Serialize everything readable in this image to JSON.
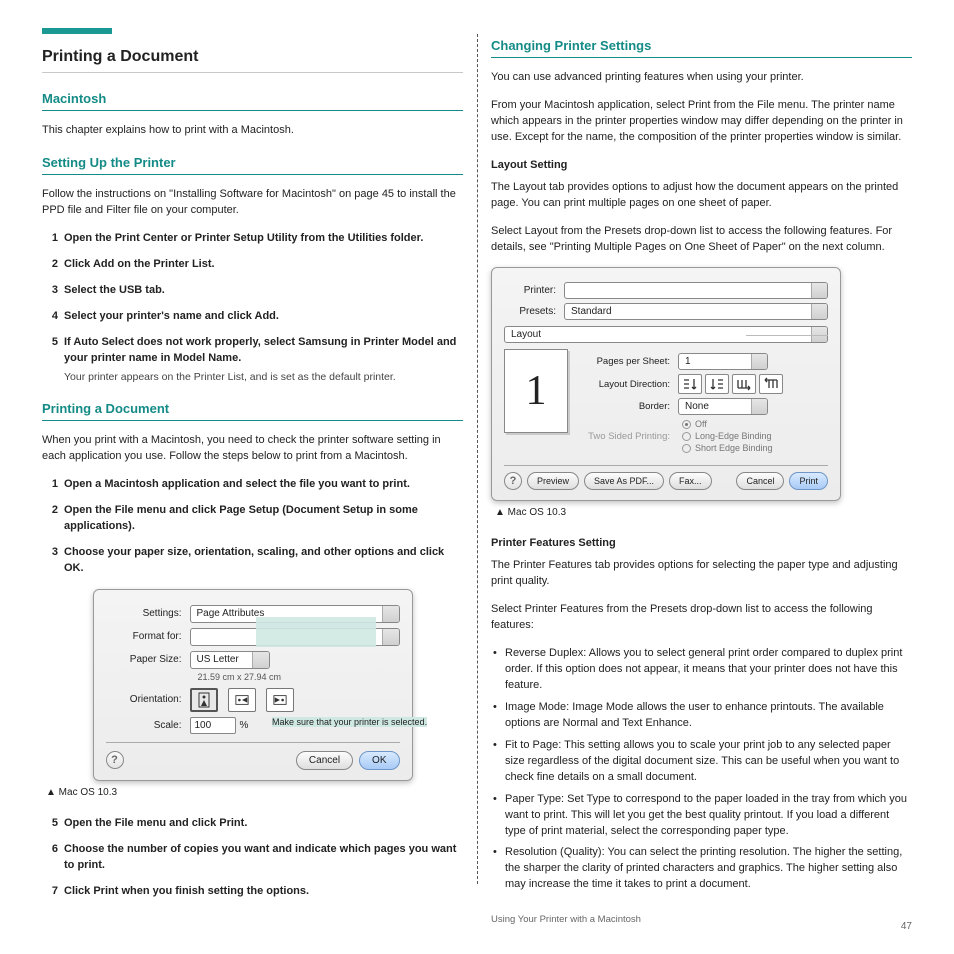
{
  "page_number": "47",
  "left": {
    "section_title": "Printing a Document",
    "sub1": "Macintosh",
    "intro": "This chapter explains how to print with a Macintosh.",
    "sub2": "Setting Up the Printer",
    "setup_text": "Follow the instructions on \"Installing Software for Macintosh\" on page 45 to install the PPD file and Filter file on your computer.",
    "steps": [
      {
        "head": "Open the Print Center or Printer Setup Utility from the Utilities folder."
      },
      {
        "head": "Click Add on the Printer List."
      },
      {
        "head": "Select the USB tab."
      },
      {
        "head": "Select your printer's name and click Add."
      },
      {
        "head": "If Auto Select does not work properly, select Samsung in Printer Model and your printer name in Model Name.",
        "sub": "Your printer appears on the Printer List, and is set as the default printer."
      }
    ],
    "sub3": "Printing a Document",
    "doc_text": "When you print with a Macintosh, you need to check the printer software setting in each application you use. Follow the steps below to print from a Macintosh.",
    "doc_steps": [
      {
        "head": "Open a Macintosh application and select the file you want to print."
      },
      {
        "head": "Open the File menu and click Page Setup (Document Setup in some applications)."
      },
      {
        "head": "Choose your paper size, orientation, scaling, and other options and click OK."
      }
    ],
    "callout_text": "Make sure that your printer is selected.",
    "caption1": "▲  Mac OS 10.3",
    "followup_steps": [
      {
        "num": "5",
        "head": "Open the File menu and click Print."
      },
      {
        "num": "6",
        "head": "Choose the number of copies you want and indicate which pages you want to print."
      },
      {
        "num": "7",
        "head": "Click Print when you finish setting the options."
      }
    ],
    "page_setup": {
      "settings_label": "Settings:",
      "settings_val": "Page Attributes",
      "format_label": "Format for:",
      "format_val": "",
      "paper_label": "Paper Size:",
      "paper_val": "US Letter",
      "paper_dim": "21.59 cm x 27.94 cm",
      "orient_label": "Orientation:",
      "scale_label": "Scale:",
      "scale_val": "100",
      "scale_suffix": "%",
      "cancel": "Cancel",
      "ok": "OK"
    }
  },
  "right": {
    "sub1": "Changing Printer Settings",
    "intro": "You can use advanced printing features when using your printer.",
    "text1": "From your Macintosh application, select Print from the File menu. The printer name which appears in the printer properties window may differ depending on the printer in use. Except for the name, the composition of the printer properties window is similar.",
    "layout_h": "Layout Setting",
    "layout_text": "The Layout tab provides options to adjust how the document appears on the printed page. You can print multiple pages on one sheet of paper.",
    "layout_text2": "Select Layout from the Presets drop-down list to access the following features. For details, see \"Printing Multiple Pages on One Sheet of Paper\" on the next column.",
    "caption2": "▲  Mac OS 10.3",
    "feat_h": "Printer Features Setting",
    "feat_text": "The Printer Features tab provides options for selecting the paper type and adjusting print quality.",
    "feat_text2": "Select Printer Features from the Presets drop-down list to access the following features:",
    "bullets": [
      "Reverse Duplex: Allows you to select general print order compared to duplex print order. If this option does not appear, it means that your printer does not have this feature.",
      "Image Mode: Image Mode allows the user to enhance printouts. The available options are Normal and Text Enhance.",
      "Fit to Page: This setting allows you to scale your print job to any selected paper size regardless of the digital document size. This can be useful when you want to check fine details on a small document.",
      "Paper Type: Set Type to correspond to the paper loaded in the tray from which you want to print. This will let you get the best quality printout. If you load a different type of print material, select the corresponding paper type.",
      "Resolution (Quality): You can select the printing resolution. The higher the setting, the sharper the clarity of printed characters and graphics. The higher setting also may increase the time it takes to print a document."
    ],
    "print_dialog": {
      "printer_label": "Printer:",
      "printer_val": "",
      "presets_label": "Presets:",
      "presets_val": "Standard",
      "panel_val": "Layout",
      "pps_label": "Pages per Sheet:",
      "pps_val": "1",
      "ld_label": "Layout Direction:",
      "border_label": "Border:",
      "border_val": "None",
      "tsp_label": "Two Sided Printing:",
      "tsp_off": "Off",
      "tsp_long": "Long-Edge Binding",
      "tsp_short": "Short Edge Binding",
      "preview": "Preview",
      "save_pdf": "Save As PDF...",
      "fax": "Fax...",
      "cancel": "Cancel",
      "print": "Print"
    },
    "foot_text": "Using Your Printer with a Macintosh"
  }
}
